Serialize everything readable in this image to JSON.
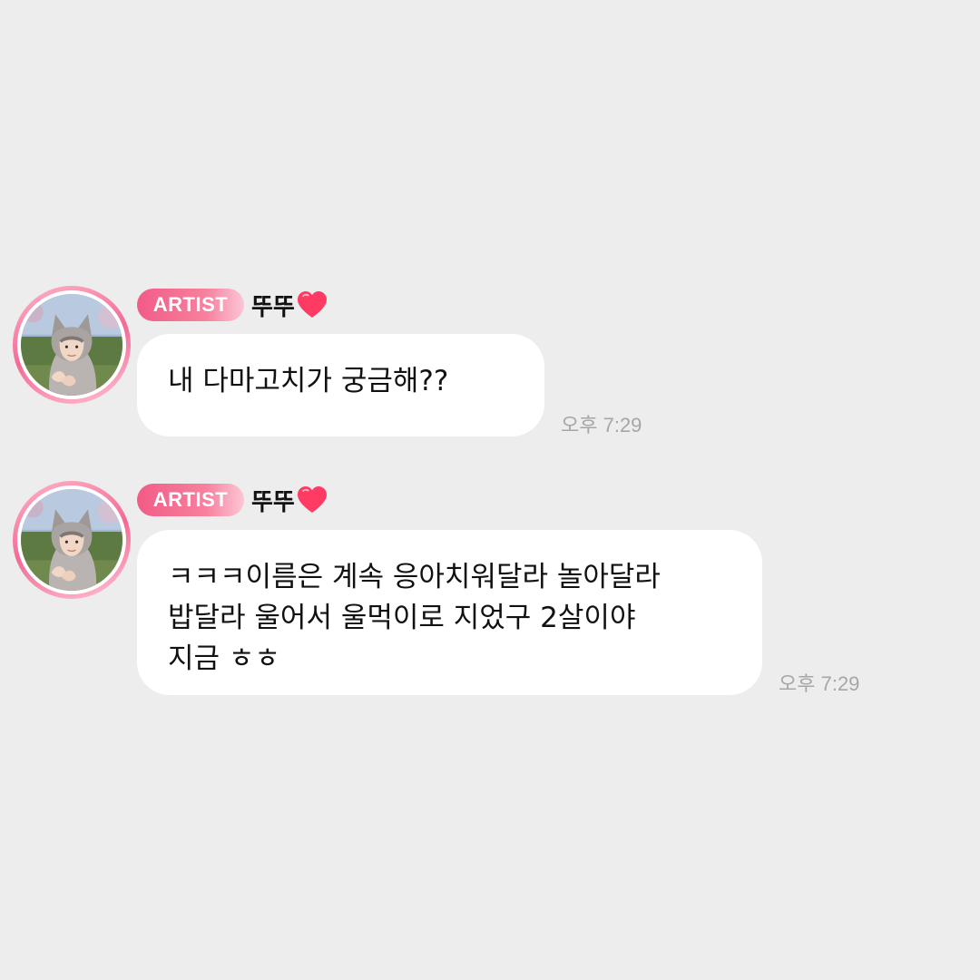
{
  "messages": [
    {
      "badge": "ARTIST",
      "name": "뚜뚜",
      "text": "내 다마고치가 궁금해??",
      "time": "오후 7:29"
    },
    {
      "badge": "ARTIST",
      "name": "뚜뚜",
      "text": "ㅋㅋㅋ이름은 계속 응아치워달라 놀아달라\n밥달라 울어서 울먹이로 지었구 2살이야\n지금 ㅎㅎ",
      "time": "오후 7:29"
    }
  ],
  "icons": {
    "heart": "heart-icon",
    "avatar": "avatar-image"
  },
  "colors": {
    "background": "#ededed",
    "bubble": "#ffffff",
    "badge_start": "#f25b86",
    "badge_end": "#fbc7d5",
    "heart": "#ff3b64",
    "time": "#a6a6a6"
  }
}
